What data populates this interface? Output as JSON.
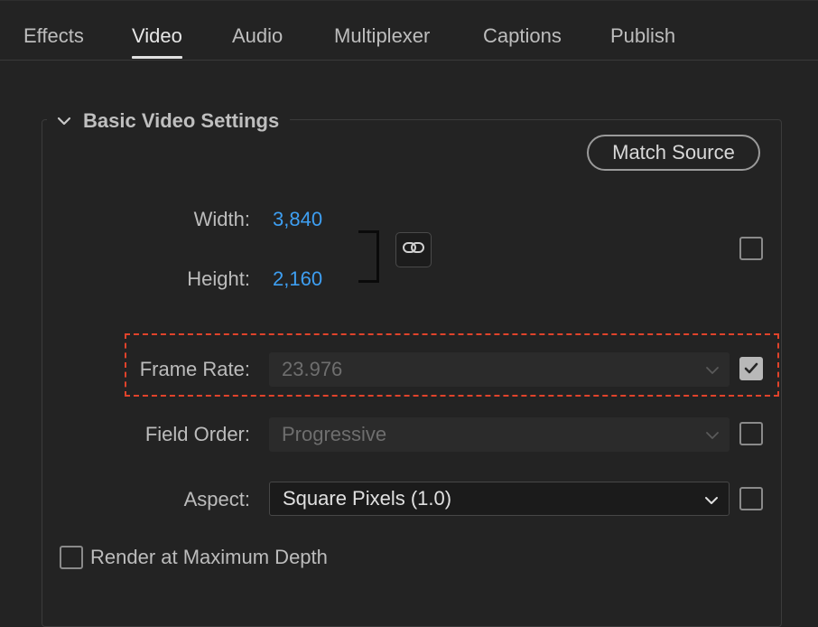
{
  "tabs": [
    {
      "label": "Effects",
      "active": false
    },
    {
      "label": "Video",
      "active": true
    },
    {
      "label": "Audio",
      "active": false
    },
    {
      "label": "Multiplexer",
      "active": false
    },
    {
      "label": "Captions",
      "active": false
    },
    {
      "label": "Publish",
      "active": false
    }
  ],
  "section": {
    "title": "Basic Video Settings",
    "expanded": true,
    "match_source_label": "Match Source"
  },
  "fields": {
    "width": {
      "label": "Width:",
      "value": "3,840"
    },
    "height": {
      "label": "Height:",
      "value": "2,160"
    },
    "dimensions_override_checked": false,
    "frame_rate": {
      "label": "Frame Rate:",
      "value": "23.976",
      "enabled": false,
      "override_checked": true
    },
    "field_order": {
      "label": "Field Order:",
      "value": "Progressive",
      "enabled": false,
      "override_checked": false
    },
    "aspect": {
      "label": "Aspect:",
      "value": "Square Pixels (1.0)",
      "enabled": true,
      "override_checked": false
    }
  },
  "render_max_depth": {
    "label": "Render at Maximum Depth",
    "checked": false
  },
  "colors": {
    "background": "#232323",
    "link_value": "#3e9ff2",
    "highlight": "#e0432b"
  },
  "icons": {
    "section_toggle": "chevron-down-icon",
    "constrain": "chain-link-icon",
    "dropdown": "chevron-down-icon",
    "checked": "checkmark-icon"
  }
}
